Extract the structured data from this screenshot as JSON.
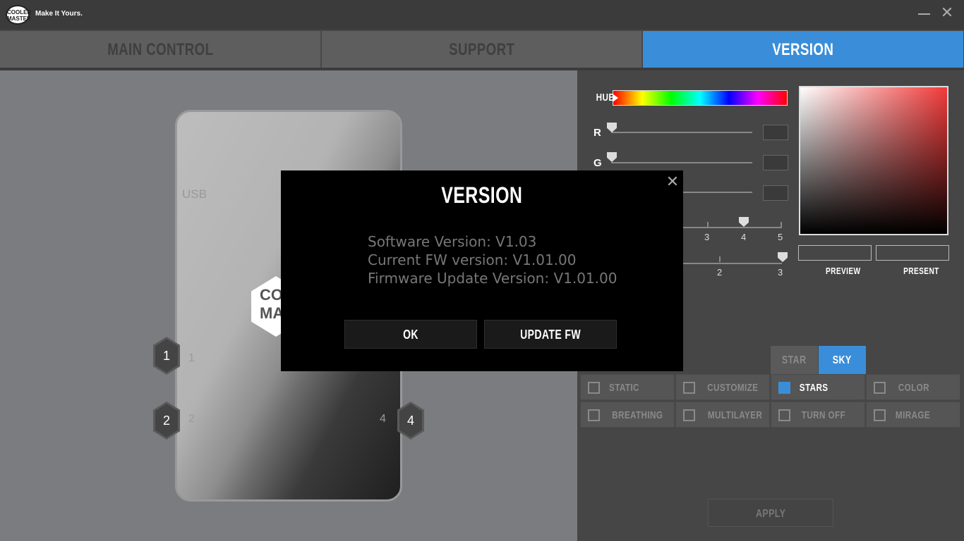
{
  "titlebar": {
    "logo_text": "COOLER MASTER",
    "tagline": "Make It Yours.",
    "minimize_icon": "minimize-icon",
    "close_icon": "close-icon",
    "close_glyph": "✕"
  },
  "tabs": [
    {
      "label": "MAIN CONTROL",
      "active": false
    },
    {
      "label": "SUPPORT",
      "active": false
    },
    {
      "label": "VERSION",
      "active": true
    }
  ],
  "device": {
    "usb_label": "USB",
    "logo_lines": [
      "COO",
      "MAS"
    ],
    "ports": [
      {
        "badge": "1",
        "label": "1"
      },
      {
        "badge": "2",
        "label": "2"
      },
      {
        "badge": "4",
        "label": "4"
      }
    ]
  },
  "color_panel": {
    "hue_label": "HUE",
    "r_label": "R",
    "g_label": "G",
    "r_value": "",
    "g_value": "",
    "b_value": "",
    "speed_ticks": [
      "3",
      "4",
      "5"
    ],
    "brightness_ticks": [
      "2",
      "3"
    ],
    "preview_label": "PREVIEW",
    "present_label": "PRESENT",
    "accent_color": "#3a8ed9"
  },
  "subtabs": [
    {
      "label": "STAR",
      "active": false
    },
    {
      "label": "SKY",
      "active": true
    }
  ],
  "modes": [
    {
      "label": "STATIC",
      "checked": false
    },
    {
      "label": "CUSTOMIZE",
      "checked": false
    },
    {
      "label": "STARS",
      "checked": true
    },
    {
      "label": "COLOR CYCLE",
      "checked": false
    },
    {
      "label": "BREATHING",
      "checked": false
    },
    {
      "label": "MULTILAYER",
      "checked": false
    },
    {
      "label": "TURN OFF",
      "checked": false
    },
    {
      "label": "MIRAGE",
      "checked": false
    }
  ],
  "apply_label": "APPLY",
  "dialog": {
    "title": "VERSION",
    "close_glyph": "✕",
    "software_version": "Software Version: V1.03",
    "current_fw": "Current FW version: V1.01.00",
    "update_fw_version": "Firmware Update Version: V1.01.00",
    "ok_label": "OK",
    "update_label": "UPDATE FW"
  }
}
